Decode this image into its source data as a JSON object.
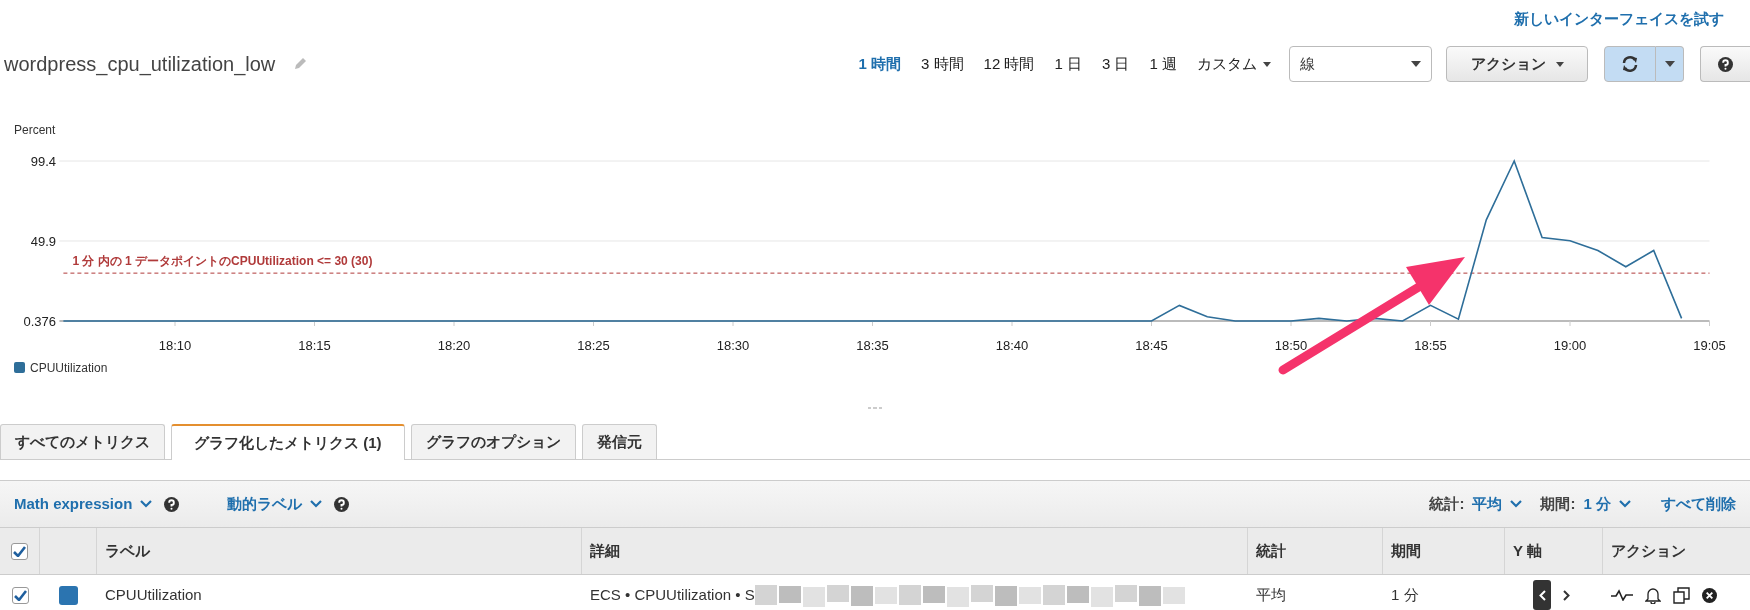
{
  "header_link": "新しいインターフェイスを試す",
  "title": "wordpress_cpu_utilization_low",
  "time_ranges": [
    {
      "label": "1 時間",
      "selected": true,
      "kind": "preset"
    },
    {
      "label": "3 時間",
      "selected": false,
      "kind": "preset"
    },
    {
      "label": "12 時間",
      "selected": false,
      "kind": "preset"
    },
    {
      "label": "1 日",
      "selected": false,
      "kind": "preset"
    },
    {
      "label": "3 日",
      "selected": false,
      "kind": "preset"
    },
    {
      "label": "1 週",
      "selected": false,
      "kind": "preset"
    },
    {
      "label": "カスタム",
      "selected": false,
      "kind": "menu"
    }
  ],
  "chart_type_select": {
    "value": "線"
  },
  "actions_button": "アクション",
  "chart": {
    "chart_data": {
      "type": "line",
      "ylabel": "Percent",
      "ylim": [
        0.376,
        99.4
      ],
      "yticks": [
        0.376,
        49.9,
        99.4
      ],
      "categories": [
        null,
        null,
        null,
        null,
        "18:10",
        null,
        null,
        null,
        null,
        "18:15",
        null,
        null,
        null,
        null,
        "18:20",
        null,
        null,
        null,
        null,
        "18:25",
        null,
        null,
        null,
        null,
        "18:30",
        null,
        null,
        null,
        null,
        "18:35",
        null,
        null,
        null,
        null,
        "18:40",
        null,
        null,
        null,
        null,
        "18:45",
        null,
        null,
        null,
        null,
        "18:50",
        null,
        null,
        null,
        null,
        "18:55",
        null,
        null,
        null,
        null,
        "19:00",
        null,
        null,
        null,
        null,
        "19:05"
      ],
      "series": [
        {
          "name": "CPUUtilization",
          "color": "#2e6e99",
          "values": [
            0.4,
            0.4,
            0.4,
            0.4,
            0.4,
            0.4,
            0.4,
            0.4,
            0.4,
            0.4,
            0.4,
            0.4,
            0.4,
            0.4,
            0.4,
            0.4,
            0.4,
            0.4,
            0.4,
            0.4,
            0.4,
            0.4,
            0.4,
            0.4,
            0.4,
            0.4,
            0.4,
            0.4,
            0.4,
            0.4,
            0.4,
            0.4,
            0.4,
            0.4,
            0.4,
            0.4,
            0.4,
            0.4,
            0.4,
            0.4,
            10,
            3,
            0.4,
            0.4,
            0.4,
            2,
            0.4,
            2,
            0.4,
            10,
            1.5,
            63,
            99.4,
            52,
            50,
            44,
            34,
            44,
            2,
            null
          ]
        }
      ],
      "ref_lines": [
        {
          "axis": "y",
          "value": 30,
          "label": "1 分 内の 1 データポイントのCPUUtilization <= 30 (30)"
        }
      ]
    }
  },
  "tabs": [
    {
      "label": "すべてのメトリクス",
      "selected": false
    },
    {
      "label": "グラフ化したメトリクス (1)",
      "selected": true
    },
    {
      "label": "グラフのオプション",
      "selected": false
    },
    {
      "label": "発信元",
      "selected": false
    }
  ],
  "toolbar": {
    "menus": [
      {
        "label": "Math expression"
      },
      {
        "label": "動的ラベル"
      }
    ],
    "statistic": {
      "label": "統計:",
      "value": "平均"
    },
    "period": {
      "label": "期間:",
      "value": "1 分"
    },
    "remove_all": "すべて削除"
  },
  "table": {
    "all_checked": true,
    "columns": [
      "ラベル",
      "詳細",
      "統計",
      "期間",
      "Y 軸",
      "アクション"
    ],
    "rows": [
      {
        "checked": true,
        "color": "#2b74b0",
        "label": "CPUUtilization",
        "details": "ECS • CPUUtilization • S",
        "statistic": "平均",
        "period": "1 分",
        "y_axis": [
          {
            "selected": true
          },
          {
            "selected": false
          }
        ]
      }
    ]
  }
}
